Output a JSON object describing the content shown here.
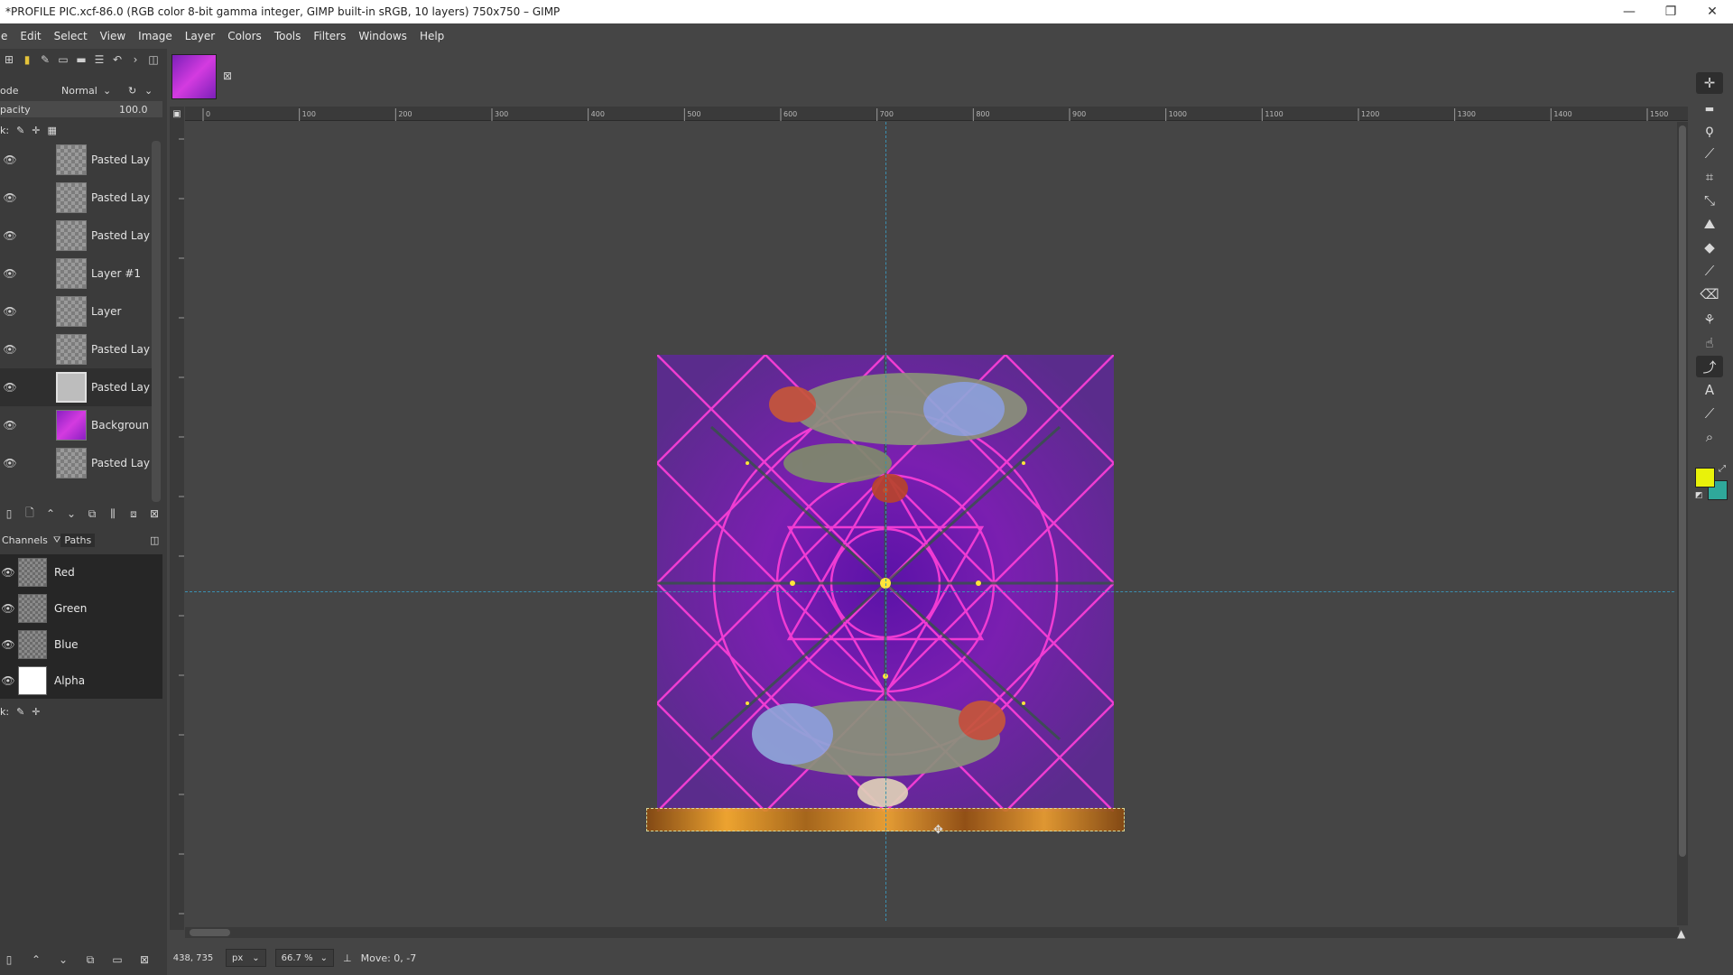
{
  "window": {
    "title": "*PROFILE PIC.xcf-86.0 (RGB color 8-bit gamma integer, GIMP built-in sRGB, 10 layers) 750x750 – GIMP",
    "minimize": "—",
    "maximize": "❐",
    "close": "✕"
  },
  "menubar": [
    "e",
    "Edit",
    "Select",
    "View",
    "Image",
    "Layer",
    "Colors",
    "Tools",
    "Filters",
    "Windows",
    "Help"
  ],
  "layers_panel": {
    "mode_label": "ode",
    "mode_value": "Normal",
    "opacity_label": "pacity",
    "opacity_value": "100.0",
    "lock_label": "k:",
    "layers": [
      {
        "name": "Pasted Lay",
        "selected": false
      },
      {
        "name": "Pasted Lay",
        "selected": false
      },
      {
        "name": "Pasted Lay",
        "selected": false
      },
      {
        "name": "Layer #1",
        "selected": false
      },
      {
        "name": "Layer",
        "selected": false
      },
      {
        "name": "Pasted Lay",
        "selected": false
      },
      {
        "name": "Pasted Lay",
        "selected": true
      },
      {
        "name": "Backgroun",
        "selected": false
      },
      {
        "name": "Pasted Lay",
        "selected": false
      }
    ]
  },
  "channels_panel": {
    "tab_channels": "Channels",
    "tab_paths": "Paths",
    "lock_label": "k:",
    "channels": [
      "Red",
      "Green",
      "Blue",
      "Alpha"
    ]
  },
  "ruler_labels": [
    "0",
    "100",
    "200",
    "300",
    "400",
    "500",
    "600",
    "700",
    "800",
    "900",
    "1000",
    "1100",
    "1200",
    "1300",
    "1400",
    "1500"
  ],
  "statusbar": {
    "coords": "438, 735",
    "unit": "px",
    "zoom": "66.7 %",
    "message": "Move: 0, -7"
  },
  "colors": {
    "foreground": "#e9f20a",
    "background": "#2fa89a",
    "guide": "#3b8fb0",
    "image_bg": "#7a1fb0",
    "pattern_pink": "#ff3fd8"
  },
  "icons": {
    "eye": "eye-icon",
    "new_layer": "new-layer-icon",
    "raise": "raise-icon",
    "lower": "lower-icon",
    "duplicate": "duplicate-icon",
    "anchor": "anchor-icon",
    "merge": "merge-icon",
    "delete": "delete-icon"
  }
}
